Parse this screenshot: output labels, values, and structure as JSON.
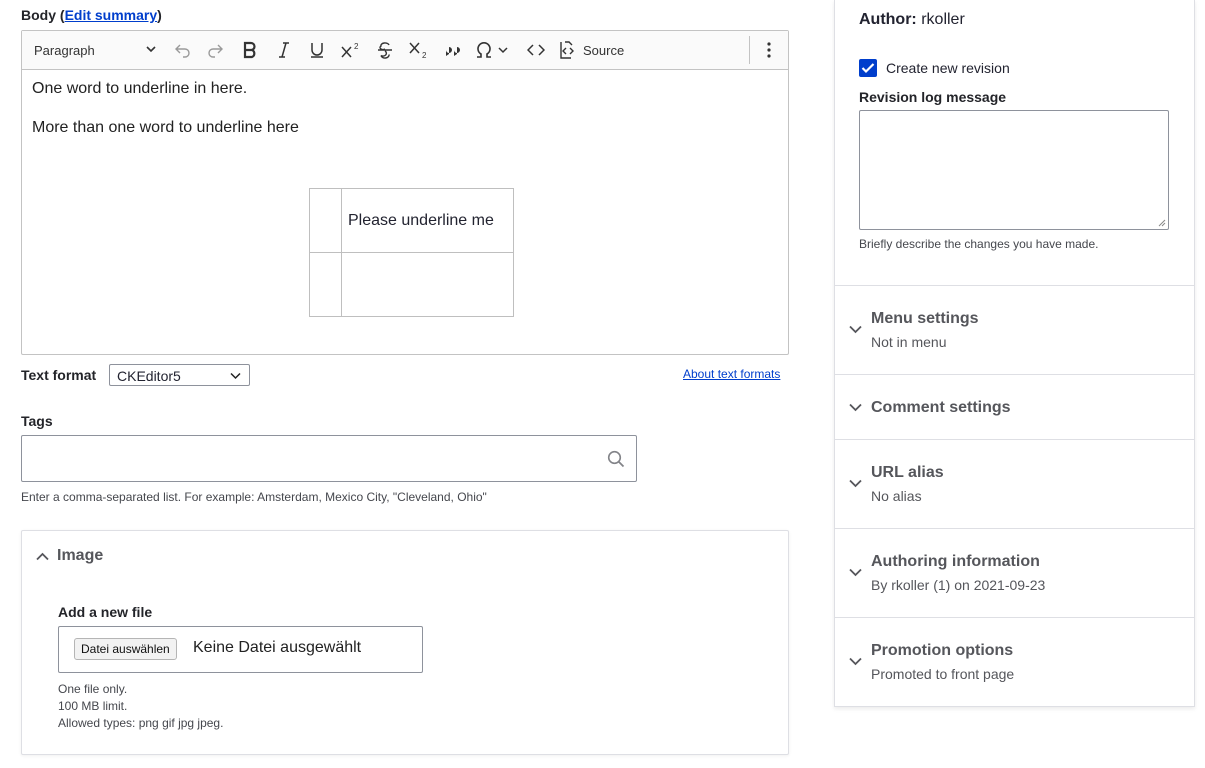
{
  "body_field": {
    "label_prefix": "Body (",
    "edit_summary_link": "Edit summary",
    "label_suffix": ")"
  },
  "editor": {
    "heading_dropdown": "Paragraph",
    "toolbar_icons": [
      "undo-icon",
      "redo-icon",
      "bold-icon",
      "italic-icon",
      "underline-icon",
      "superscript-icon",
      "strikethrough-icon",
      "subscript-icon",
      "block-quote-icon",
      "special-characters-icon",
      "code-icon",
      "source-editing-icon",
      "more-items-icon"
    ],
    "source_label": "Source",
    "paragraph_1": "One word to underline in here.",
    "paragraph_2": "More than one word to underline here",
    "table_cells": [
      [
        "",
        "Please underline me"
      ],
      [
        "",
        ""
      ]
    ]
  },
  "text_format": {
    "label": "Text format",
    "selected": "CKEditor5",
    "about_link": "About text formats"
  },
  "tags": {
    "label": "Tags",
    "value": "",
    "description": "Enter a comma-separated list. For example: Amsterdam, Mexico City, \"Cleveland, Ohio\""
  },
  "image_section": {
    "summary": "Image",
    "file_label": "Add a new file",
    "choose_button": "Datei auswählen",
    "no_file_text": "Keine Datei ausgewählt",
    "desc_1": "One file only.",
    "desc_2": "100 MB limit.",
    "desc_3": "Allowed types: png gif jpg jpeg."
  },
  "sidebar": {
    "author_label": "Author:",
    "author_name": "rkoller",
    "create_revision_label": "Create new revision",
    "create_revision_checked": true,
    "revision_log_label": "Revision log message",
    "revision_log_value": "",
    "revision_log_desc": "Briefly describe the changes you have made.",
    "sections": [
      {
        "title": "Menu settings",
        "summary": "Not in menu"
      },
      {
        "title": "Comment settings",
        "summary": ""
      },
      {
        "title": "URL alias",
        "summary": "No alias"
      },
      {
        "title": "Authoring information",
        "summary": "By rkoller (1) on 2021-09-23"
      },
      {
        "title": "Promotion options",
        "summary": "Promoted to front page"
      }
    ]
  },
  "colors": {
    "accent": "#003ecc",
    "text": "#222330",
    "muted": "#55565b",
    "border": "#dedfe4"
  }
}
